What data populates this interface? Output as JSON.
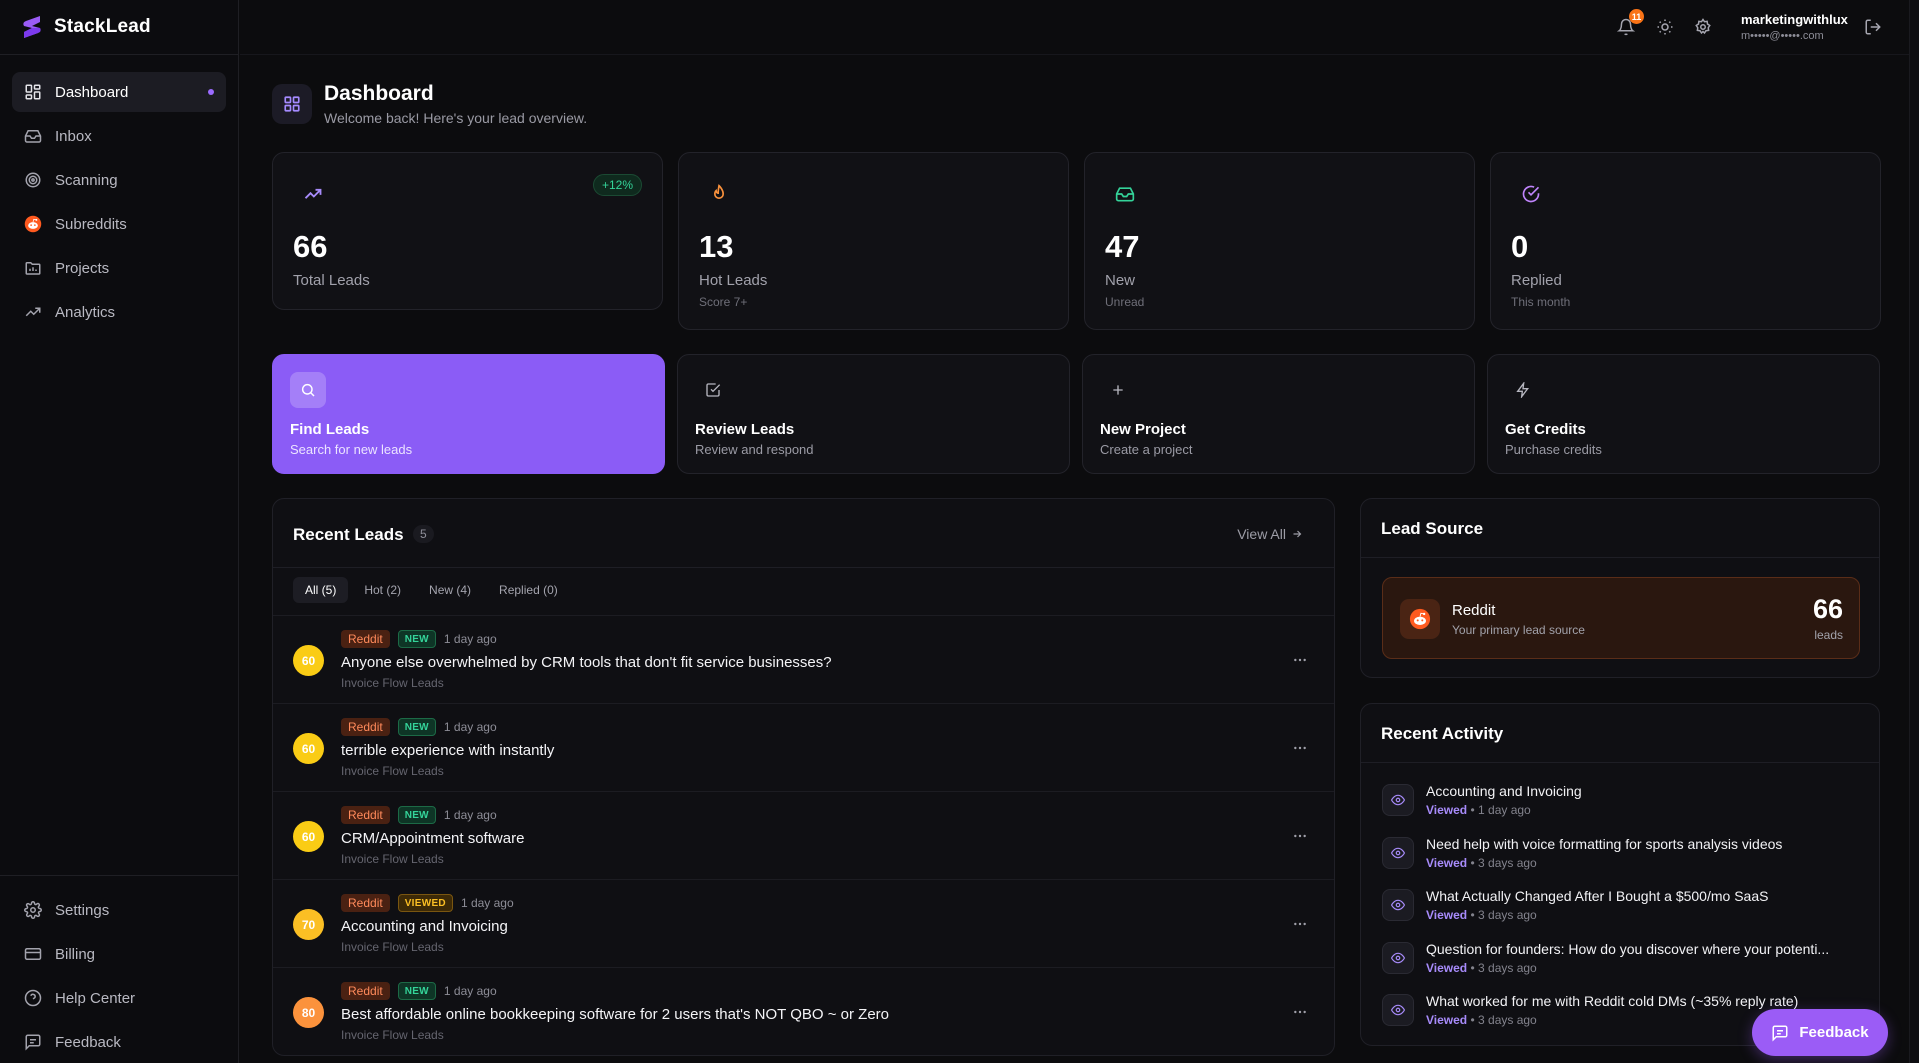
{
  "brand": {
    "name": "StackLead"
  },
  "sidebar": {
    "items": [
      {
        "label": "Dashboard",
        "icon": "grid-icon",
        "active": true
      },
      {
        "label": "Inbox",
        "icon": "inbox-icon"
      },
      {
        "label": "Scanning",
        "icon": "radar-icon"
      },
      {
        "label": "Subreddits",
        "icon": "reddit-icon"
      },
      {
        "label": "Projects",
        "icon": "folder-icon"
      },
      {
        "label": "Analytics",
        "icon": "trend-icon"
      }
    ],
    "bottom": [
      {
        "label": "Settings",
        "icon": "gear-icon"
      },
      {
        "label": "Billing",
        "icon": "card-icon"
      },
      {
        "label": "Help Center",
        "icon": "help-icon"
      },
      {
        "label": "Feedback",
        "icon": "feedback-icon"
      }
    ]
  },
  "topbar": {
    "notification_count": "11",
    "user_name": "marketingwithlux",
    "user_email": "m•••••@•••••.com"
  },
  "header": {
    "title": "Dashboard",
    "subtitle": "Welcome back! Here's your lead overview."
  },
  "stats": [
    {
      "value": "66",
      "label": "Total Leads",
      "sub": "",
      "badge": "+12%",
      "icon": "trend-up-icon",
      "color": "#a78bfa"
    },
    {
      "value": "13",
      "label": "Hot Leads",
      "sub": "Score 7+",
      "badge": "",
      "icon": "flame-icon",
      "color": "#fb923c"
    },
    {
      "value": "47",
      "label": "New",
      "sub": "Unread",
      "badge": "",
      "icon": "inbox-icon",
      "color": "#34d399"
    },
    {
      "value": "0",
      "label": "Replied",
      "sub": "This month",
      "badge": "",
      "icon": "check-circle-icon",
      "color": "#c084fc"
    }
  ],
  "actions": [
    {
      "title": "Find Leads",
      "sub": "Search for new leads",
      "icon": "search-icon"
    },
    {
      "title": "Review Leads",
      "sub": "Review and respond",
      "icon": "checkbox-icon"
    },
    {
      "title": "New Project",
      "sub": "Create a project",
      "icon": "plus-icon"
    },
    {
      "title": "Get Credits",
      "sub": "Purchase credits",
      "icon": "bolt-icon"
    }
  ],
  "recent_leads": {
    "title": "Recent Leads",
    "count": "5",
    "view_all": "View All",
    "filters": [
      "All (5)",
      "Hot (2)",
      "New (4)",
      "Replied (0)"
    ],
    "rows": [
      {
        "score": "60",
        "score_color": "#facc15",
        "source": "Reddit",
        "status": "NEW",
        "status_type": "new",
        "time": "1 day ago",
        "title": "Anyone else overwhelmed by CRM tools that don't fit service businesses?",
        "project": "Invoice Flow Leads"
      },
      {
        "score": "60",
        "score_color": "#facc15",
        "source": "Reddit",
        "status": "NEW",
        "status_type": "new",
        "time": "1 day ago",
        "title": "terrible experience with instantly",
        "project": "Invoice Flow Leads"
      },
      {
        "score": "60",
        "score_color": "#facc15",
        "source": "Reddit",
        "status": "NEW",
        "status_type": "new",
        "time": "1 day ago",
        "title": "CRM/Appointment software",
        "project": "Invoice Flow Leads"
      },
      {
        "score": "70",
        "score_color": "#fbbf24",
        "source": "Reddit",
        "status": "VIEWED",
        "status_type": "viewed",
        "time": "1 day ago",
        "title": "Accounting and Invoicing",
        "project": "Invoice Flow Leads"
      },
      {
        "score": "80",
        "score_color": "#fb923c",
        "source": "Reddit",
        "status": "NEW",
        "status_type": "new",
        "time": "1 day ago",
        "title": "Best affordable online bookkeeping software for 2 users that's NOT QBO ~ or Zero",
        "project": "Invoice Flow Leads"
      }
    ]
  },
  "lead_source": {
    "title": "Lead Source",
    "name": "Reddit",
    "sub": "Your primary lead source",
    "count": "66",
    "unit": "leads"
  },
  "activity": {
    "title": "Recent Activity",
    "items": [
      {
        "title": "Accounting and Invoicing",
        "status": "Viewed",
        "time": "• 1 day ago"
      },
      {
        "title": "Need help with voice formatting for sports analysis videos",
        "status": "Viewed",
        "time": "• 3 days ago"
      },
      {
        "title": "What Actually Changed After I Bought a $500/mo SaaS",
        "status": "Viewed",
        "time": "• 3 days ago"
      },
      {
        "title": "Question for founders: How do you discover where your potenti...",
        "status": "Viewed",
        "time": "• 3 days ago"
      },
      {
        "title": "What worked for me with Reddit cold DMs (~35% reply rate)",
        "status": "Viewed",
        "time": "• 3 days ago"
      }
    ]
  },
  "feedback_button": {
    "label": "Feedback"
  },
  "colors": {
    "accent": "#8b5cf6",
    "reddit": "#ff5a1f",
    "background": "#0c0c0e"
  }
}
